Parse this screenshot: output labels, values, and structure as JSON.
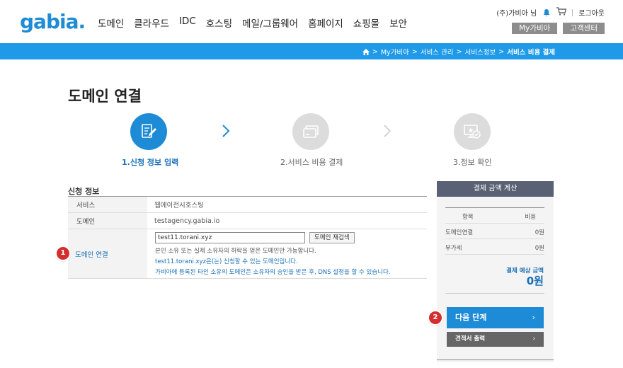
{
  "header": {
    "logo": "gabia.",
    "nav": [
      "도메인",
      "클라우드",
      "IDC",
      "호스팅",
      "메일/그룹웨어",
      "홈페이지",
      "쇼핑몰",
      "보안"
    ],
    "user": "(주)가비아 님",
    "logout": "로그아웃",
    "mygabia": "My가비아",
    "support": "고객센터"
  },
  "breadcrumb": {
    "items": [
      "My가비아",
      "서비스 관리",
      "서비스정보"
    ],
    "current": "서비스 비용 결제",
    "sep": ">"
  },
  "page": {
    "title": "도메인 연결"
  },
  "steps": [
    {
      "label": "1.신청 정보 입력",
      "active": true
    },
    {
      "label": "2.서비스 비용 결제",
      "active": false
    },
    {
      "label": "3.정보 확인",
      "active": false
    }
  ],
  "info": {
    "title": "신청 정보",
    "rows": [
      {
        "label": "서비스",
        "value": "웹에이전시호스팅"
      },
      {
        "label": "도메인",
        "value": "testagency.gabia.io"
      }
    ],
    "domain_link": {
      "label": "도메인 연결",
      "input_value": "test11.torani.xyz",
      "recheck_label": "도메인 재검색",
      "desc1": "본인 소유 또는 실제 소유자의 허락을 얻은 도메인만 가능합니다.",
      "desc2": "test11.torani.xyz은(는) 신청할 수 있는 도메인입니다.",
      "desc3": "가비아에 등록된 타인 소유의 도메인은 소유자의 승인을 받은 후, DNS 설정을 할 수 있습니다."
    }
  },
  "markers": [
    "1",
    "2"
  ],
  "summary": {
    "title": "결제 금액 계산",
    "col_item": "항목",
    "col_cost": "비용",
    "rows": [
      {
        "item": "도메인연결",
        "cost": "0원"
      },
      {
        "item": "부가세",
        "cost": "0원"
      }
    ],
    "expect_label": "결제 예상 금액",
    "expect_value": "0원",
    "next_label": "다음 단계",
    "quote_label": "견적서 출력",
    "arrow": "›"
  },
  "colors": {
    "primary": "#1e8bd6",
    "bar": "#1e9ae8",
    "marker": "#d32f2f",
    "side_head": "#5a6174"
  }
}
